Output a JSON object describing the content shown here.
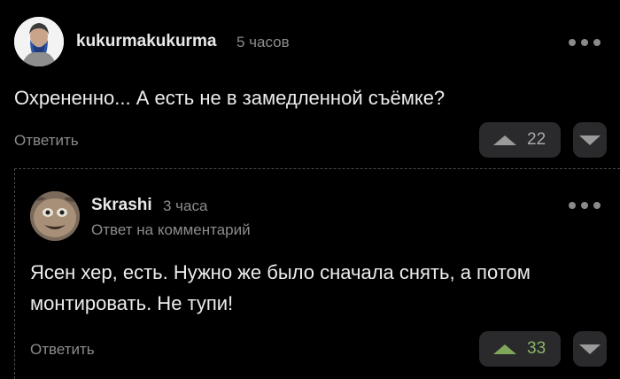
{
  "comment": {
    "author": "kukurmakukurma",
    "time": "5 часов",
    "text": "Охрененно... А есть не в замедленной съёмке?",
    "reply_label": "Ответить",
    "votes": "22",
    "avatar_icon": "bearded-man-avatar",
    "more_icon": "more-dots-icon"
  },
  "reply": {
    "author": "Skrashi",
    "time": "3 часа",
    "subtitle": "Ответ на комментарий",
    "text_line1": "Ясен хер, есть. Нужно же было сначала снять, а потом",
    "text_line2": "монтировать. Не тупи!",
    "reply_label": "Ответить",
    "votes": "33",
    "votes_color": "#8ab466",
    "avatar_icon": "creature-avatar",
    "more_icon": "more-dots-icon"
  },
  "colors": {
    "background": "#000000",
    "button_bg": "#2a2a2c",
    "muted_text": "#8c8c8c",
    "upvoted_green": "#7fa65a"
  }
}
